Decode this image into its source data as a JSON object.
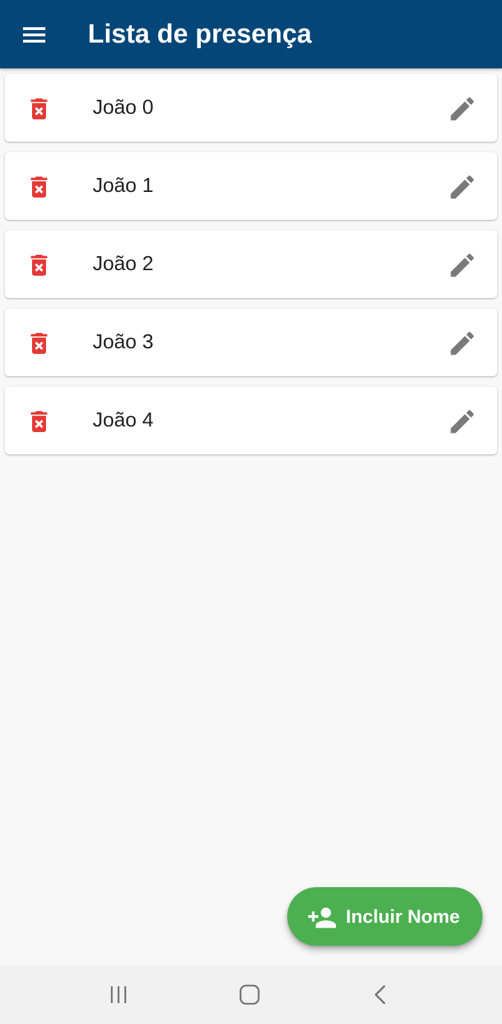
{
  "app_bar": {
    "title": "Lista de presença",
    "menu_icon": "hamburger-menu-icon",
    "background_color": "#054678"
  },
  "attendance_list": {
    "items": [
      {
        "name": "João 0",
        "delete_icon": "delete-forever-icon",
        "edit_icon": "pencil-icon"
      },
      {
        "name": "João 1",
        "delete_icon": "delete-forever-icon",
        "edit_icon": "pencil-icon"
      },
      {
        "name": "João 2",
        "delete_icon": "delete-forever-icon",
        "edit_icon": "pencil-icon"
      },
      {
        "name": "João 3",
        "delete_icon": "delete-forever-icon",
        "edit_icon": "pencil-icon"
      },
      {
        "name": "João 4",
        "delete_icon": "delete-forever-icon",
        "edit_icon": "pencil-icon"
      }
    ],
    "delete_color": "#e53935",
    "edit_color": "#7a7a7a"
  },
  "fab": {
    "label": "Incluir Nome",
    "icon": "person-add-icon",
    "color": "#4caf50"
  },
  "system_nav": {
    "buttons": [
      "recent-apps-icon",
      "home-icon",
      "back-icon"
    ]
  }
}
